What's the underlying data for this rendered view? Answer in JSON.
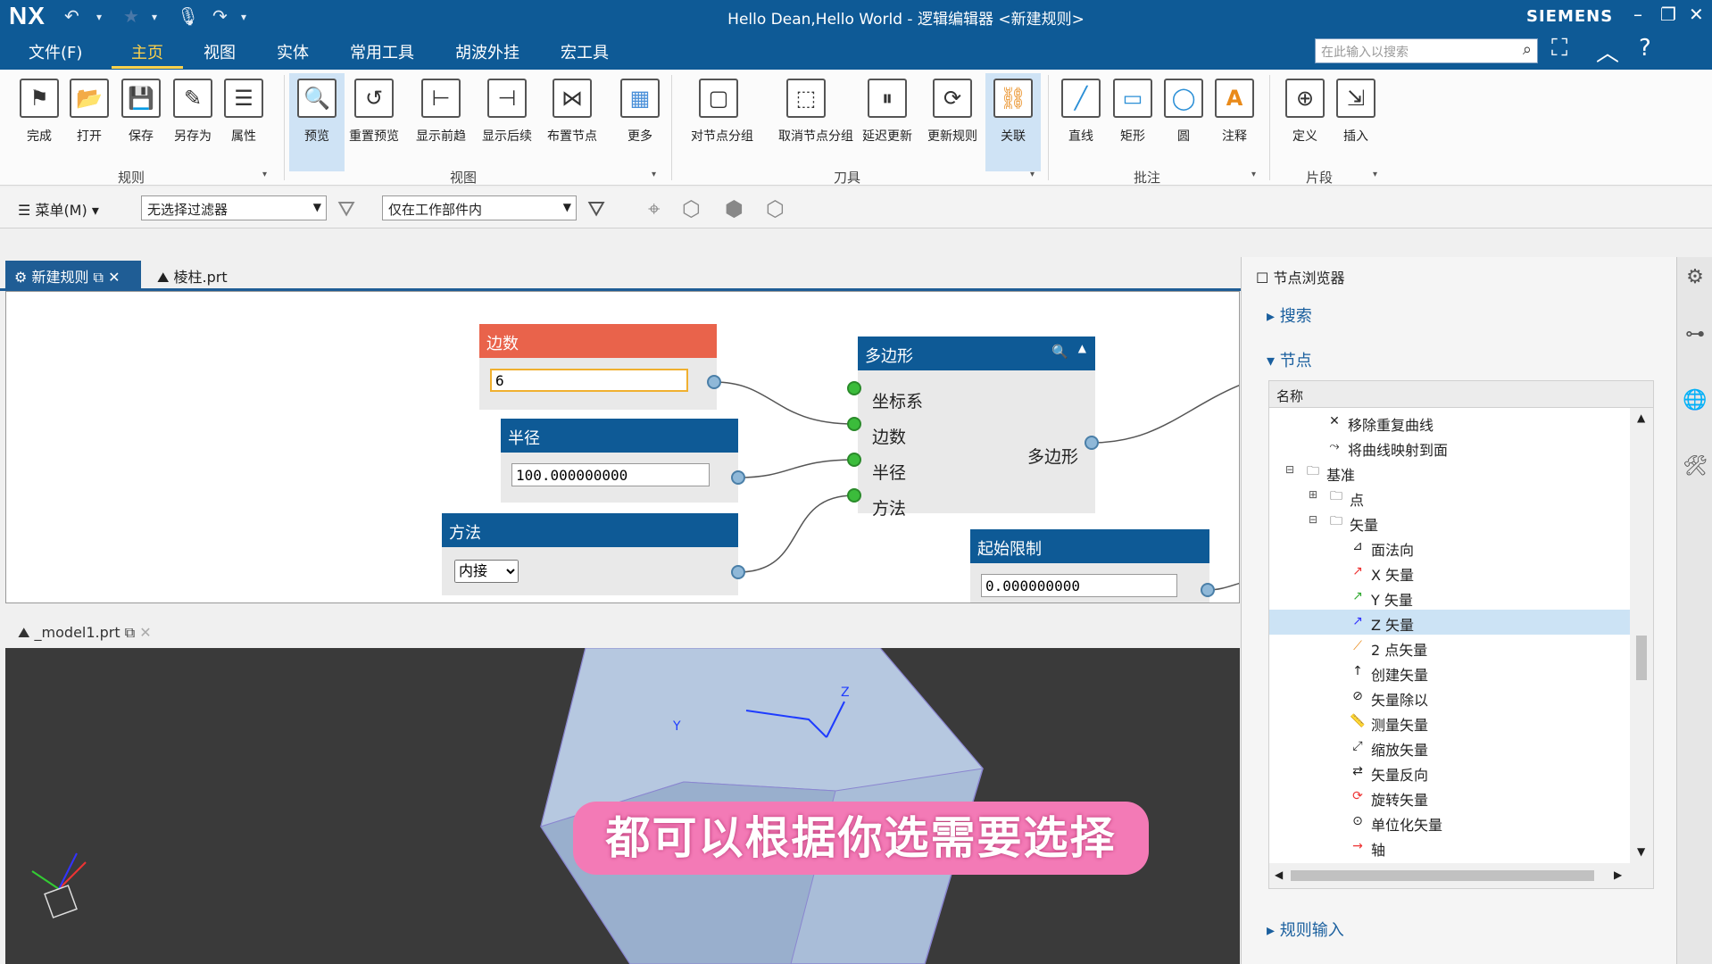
{
  "titlebar": {
    "logo": "NX",
    "title": "Hello Dean,Hello World - 逻辑编辑器 <新建规则>",
    "brand": "SIEMENS"
  },
  "menubar": {
    "items": [
      "文件(F)",
      "主页",
      "视图",
      "实体",
      "常用工具",
      "胡波外挂",
      "宏工具"
    ],
    "search_placeholder": "在此输入以搜索"
  },
  "ribbon": {
    "groups": [
      "规则",
      "视图",
      "刀具",
      "批注",
      "片段"
    ],
    "buttons": [
      "完成",
      "打开",
      "保存",
      "另存为",
      "属性",
      "预览",
      "重置预览",
      "显示前趋",
      "显示后续",
      "布置节点",
      "更多",
      "对节点分组",
      "取消节点分组",
      "延迟更新",
      "更新规则",
      "关联",
      "直线",
      "矩形",
      "圆",
      "注释",
      "定义",
      "插入"
    ]
  },
  "filterbar": {
    "menu": "菜单(M)",
    "filter1": "无选择过滤器",
    "filter2": "仅在工作部件内"
  },
  "editor_tabs": {
    "tab1": "新建规则",
    "tab2": "棱柱.prt"
  },
  "nodes": {
    "sides": {
      "title": "边数",
      "value": "6"
    },
    "radius": {
      "title": "半径",
      "value": "100.000000000"
    },
    "method": {
      "title": "方法",
      "value": "内接"
    },
    "polygon": {
      "title": "多边形",
      "ports": [
        "坐标系",
        "边数",
        "半径",
        "方法"
      ],
      "output": "多边形"
    },
    "start": {
      "title": "起始限制",
      "value": "0.000000000"
    }
  },
  "view_tab": "_model1.prt",
  "subtitle": "都可以根据你选需要选择",
  "right_panel": {
    "title": "节点浏览器",
    "search": "搜索",
    "nodes": "节点",
    "column": "名称",
    "rule_input": "规则输入",
    "tree": [
      {
        "label": "移除重复曲线"
      },
      {
        "label": "将曲线映射到面"
      },
      {
        "label": "基准"
      },
      {
        "label": "点"
      },
      {
        "label": "矢量"
      },
      {
        "label": "面法向"
      },
      {
        "label": "X 矢量"
      },
      {
        "label": "Y 矢量"
      },
      {
        "label": "Z 矢量"
      },
      {
        "label": "2 点矢量"
      },
      {
        "label": "创建矢量"
      },
      {
        "label": "矢量除以"
      },
      {
        "label": "测量矢量"
      },
      {
        "label": "缩放矢量"
      },
      {
        "label": "矢量反向"
      },
      {
        "label": "旋转矢量"
      },
      {
        "label": "单位化矢量"
      },
      {
        "label": "轴"
      }
    ]
  }
}
